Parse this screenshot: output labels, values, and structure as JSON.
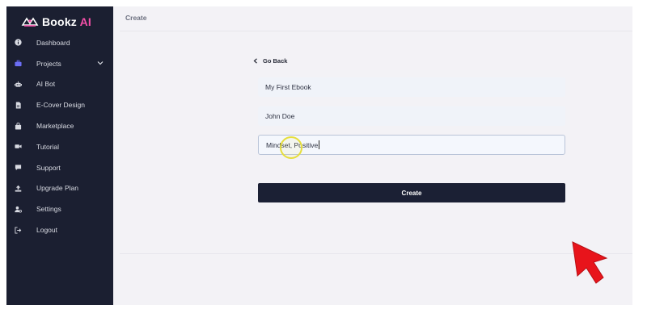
{
  "app": {
    "brand_main": "Bookz",
    "brand_accent": "AI",
    "accent_color": "#6c6ef5",
    "brand_pink": "#f54fa9"
  },
  "sidebar": {
    "items": [
      {
        "label": "Dashboard",
        "icon": "info-icon"
      },
      {
        "label": "Projects",
        "icon": "briefcase-icon",
        "active": true,
        "expandable": true
      },
      {
        "label": "AI Bot",
        "icon": "robot-icon"
      },
      {
        "label": "E-Cover Design",
        "icon": "file-icon"
      },
      {
        "label": "Marketplace",
        "icon": "bag-icon"
      },
      {
        "label": "Tutorial",
        "icon": "video-icon"
      },
      {
        "label": "Support",
        "icon": "chat-icon"
      },
      {
        "label": "Upgrade Plan",
        "icon": "upload-icon"
      },
      {
        "label": "Settings",
        "icon": "user-gear-icon"
      },
      {
        "label": "Logout",
        "icon": "logout-icon"
      }
    ]
  },
  "main": {
    "title": "Create",
    "go_back": "Go Back",
    "fields": [
      {
        "value": "My First Ebook"
      },
      {
        "value": "John Doe"
      },
      {
        "value": "Mindset, Positive",
        "focused": true
      }
    ],
    "create_button": "Create"
  }
}
